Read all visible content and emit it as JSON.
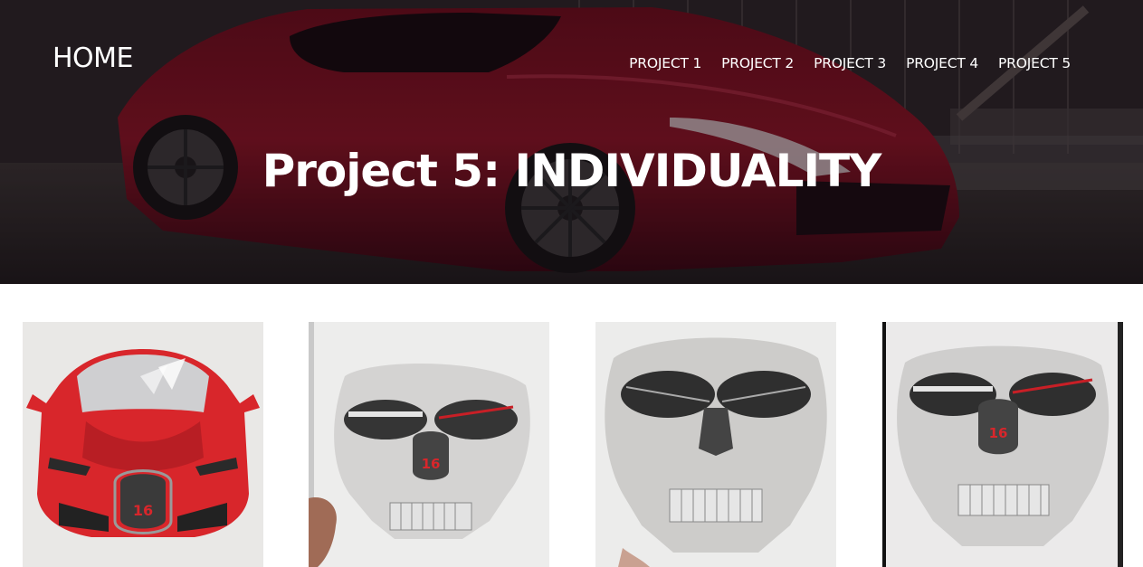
{
  "header": {
    "home_label": "HOME",
    "nav": [
      {
        "label": "PROJECT 1"
      },
      {
        "label": "PROJECT 2"
      },
      {
        "label": "PROJECT 3"
      },
      {
        "label": "PROJECT 4"
      },
      {
        "label": "PROJECT 5"
      }
    ]
  },
  "hero": {
    "title": "Project 5: INDIVIDUALITY"
  },
  "gallery": {
    "images": [
      {
        "icon": "red-car-drawing",
        "plate_text": "16"
      },
      {
        "icon": "skull-drawing-with-grille",
        "plate_text": "16"
      },
      {
        "icon": "skull-pencil-drawing"
      },
      {
        "icon": "skull-drawing-with-grille",
        "plate_text": "16"
      }
    ]
  },
  "colors": {
    "hero_car": "#7a0d18",
    "drawing_red": "#d8262b",
    "text": "#ffffff"
  }
}
